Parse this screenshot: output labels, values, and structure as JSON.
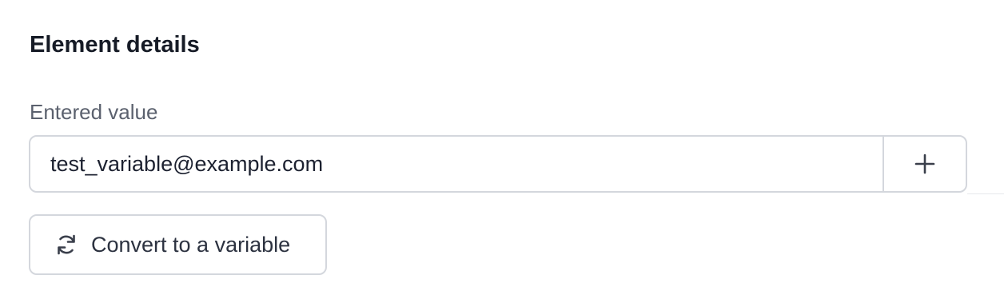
{
  "section": {
    "title": "Element details"
  },
  "entered_value": {
    "label": "Entered value",
    "value": "test_variable@example.com"
  },
  "icons": {
    "add": "plus-icon",
    "convert": "refresh-icon"
  },
  "actions": {
    "convert_label": "Convert to a variable"
  },
  "colors": {
    "border": "#d4d7dd",
    "heading": "#161b26",
    "label": "#5b616e",
    "text": "#1c2130",
    "icon": "#3a3f4b"
  }
}
